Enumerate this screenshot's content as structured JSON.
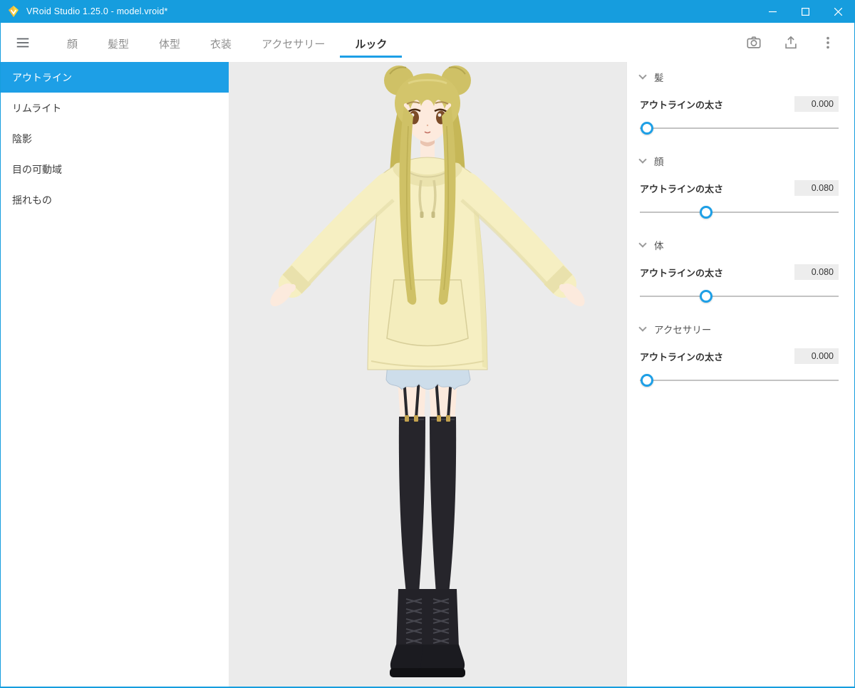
{
  "window": {
    "title": "VRoid Studio 1.25.0 - model.vroid*"
  },
  "nav": {
    "tabs": [
      {
        "label": "顔"
      },
      {
        "label": "髪型"
      },
      {
        "label": "体型"
      },
      {
        "label": "衣装"
      },
      {
        "label": "アクセサリー"
      },
      {
        "label": "ルック",
        "active": true
      }
    ]
  },
  "sidebar": {
    "items": [
      {
        "label": "アウトライン",
        "selected": true
      },
      {
        "label": "リムライト"
      },
      {
        "label": "陰影"
      },
      {
        "label": "目の可動域"
      },
      {
        "label": "揺れもの"
      }
    ]
  },
  "panel": {
    "sections": [
      {
        "title": "髪",
        "param": "アウトラインの太さ",
        "value": "0.000",
        "slider_pct": 3.5
      },
      {
        "title": "顔",
        "param": "アウトラインの太さ",
        "value": "0.080",
        "slider_pct": 33.5
      },
      {
        "title": "体",
        "param": "アウトラインの太さ",
        "value": "0.080",
        "slider_pct": 33.5
      },
      {
        "title": "アクセサリー",
        "param": "アウトラインの太さ",
        "value": "0.000",
        "slider_pct": 3.5
      }
    ]
  },
  "colors": {
    "titlebar": "#169dde",
    "accent": "#1d9fe6",
    "viewport_bg": "#ebebeb"
  }
}
